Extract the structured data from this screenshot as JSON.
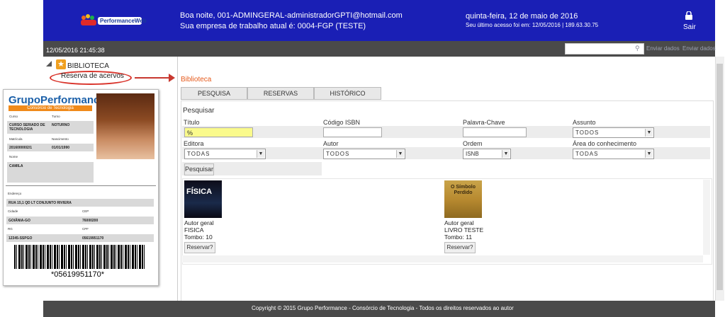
{
  "header": {
    "logo_text": "PerformanceWeb",
    "greeting": "Boa noite, 001-ADMINGERAL-administradorGPTI@hotmail.com",
    "company": "Sua empresa de trabalho atual é: 0004-FGP (TESTE)",
    "date": "quinta-feira, 12 de maio de 2016",
    "last_access": "Seu último acesso foi em: 12/05/2016 | 189.63.30.75",
    "logout_label": "Sair",
    "accent_color": "#1a1fb5"
  },
  "toolbar": {
    "clock": "12/05/2016 21:45:38",
    "send_data_1": "Enviar dados",
    "send_data_2": "Enviar dados"
  },
  "sidebar": {
    "section": "BIBLIOTECA",
    "item": "Reserva de acervos"
  },
  "card": {
    "brand": "GrupoPerformance",
    "subtitle": "Consórcio de Tecnologia",
    "curso_label": "Curso",
    "turno_label": "Turno",
    "curso_value": "CURSO SERIADO DE TECNOLOGIA",
    "turno_value": "NOTURNO",
    "matricula_label": "Matrícula",
    "nascimento_label": "Nascimento",
    "matricula_value": "2016000002/1",
    "nascimento_value": "01/01/1990",
    "nome_label": "Nome",
    "nome_value": "CAMILA",
    "endereco_label": "Endereço",
    "endereco_value": "RUA 15,1 QD LT CONJUNTO RIVIERA",
    "cidade_label": "Cidade",
    "cep_label": "CEP",
    "cidade_value": "GOIÂNIA-GO",
    "cep_value": "76000200",
    "rg_label": "RG",
    "cpf_label": "CPF",
    "rg_value": "12345-SSPGO",
    "cpf_value": "05619951170",
    "barcode_text": "*05619951170*"
  },
  "main": {
    "title": "Biblioteca",
    "tabs": [
      "PESQUISA",
      "RESERVAS",
      "HISTÓRICO"
    ],
    "search_heading": "Pesquisar",
    "fields": {
      "titulo_label": "Título",
      "titulo_value": "%",
      "isbn_label": "Código ISBN",
      "palavra_label": "Palavra-Chave",
      "assunto_label": "Assunto",
      "assunto_value": "TODOS",
      "editora_label": "Editora",
      "editora_value": "TODAS",
      "autor_label": "Autor",
      "autor_value": "TODOS",
      "ordem_label": "Ordem",
      "ordem_value": "ISNB",
      "area_label": "Área do conhecimento",
      "area_value": "TODAS"
    },
    "search_button": "Pesquisar",
    "books": [
      {
        "cover_title": "FÍSICA",
        "author": "Autor geral",
        "title": "FISICA",
        "tombo": "Tombo: 10",
        "reserve": "Reservar?"
      },
      {
        "cover_title": "O Símbolo Perdido",
        "author": "Autor geral",
        "title": "LIVRO TESTE",
        "tombo": "Tombo: 11",
        "reserve": "Reservar?"
      }
    ]
  },
  "footer": {
    "text": "Copyright © 2015 Grupo Performance - Consórcio de Tecnologia - Todos os direitos reservados ao autor"
  }
}
